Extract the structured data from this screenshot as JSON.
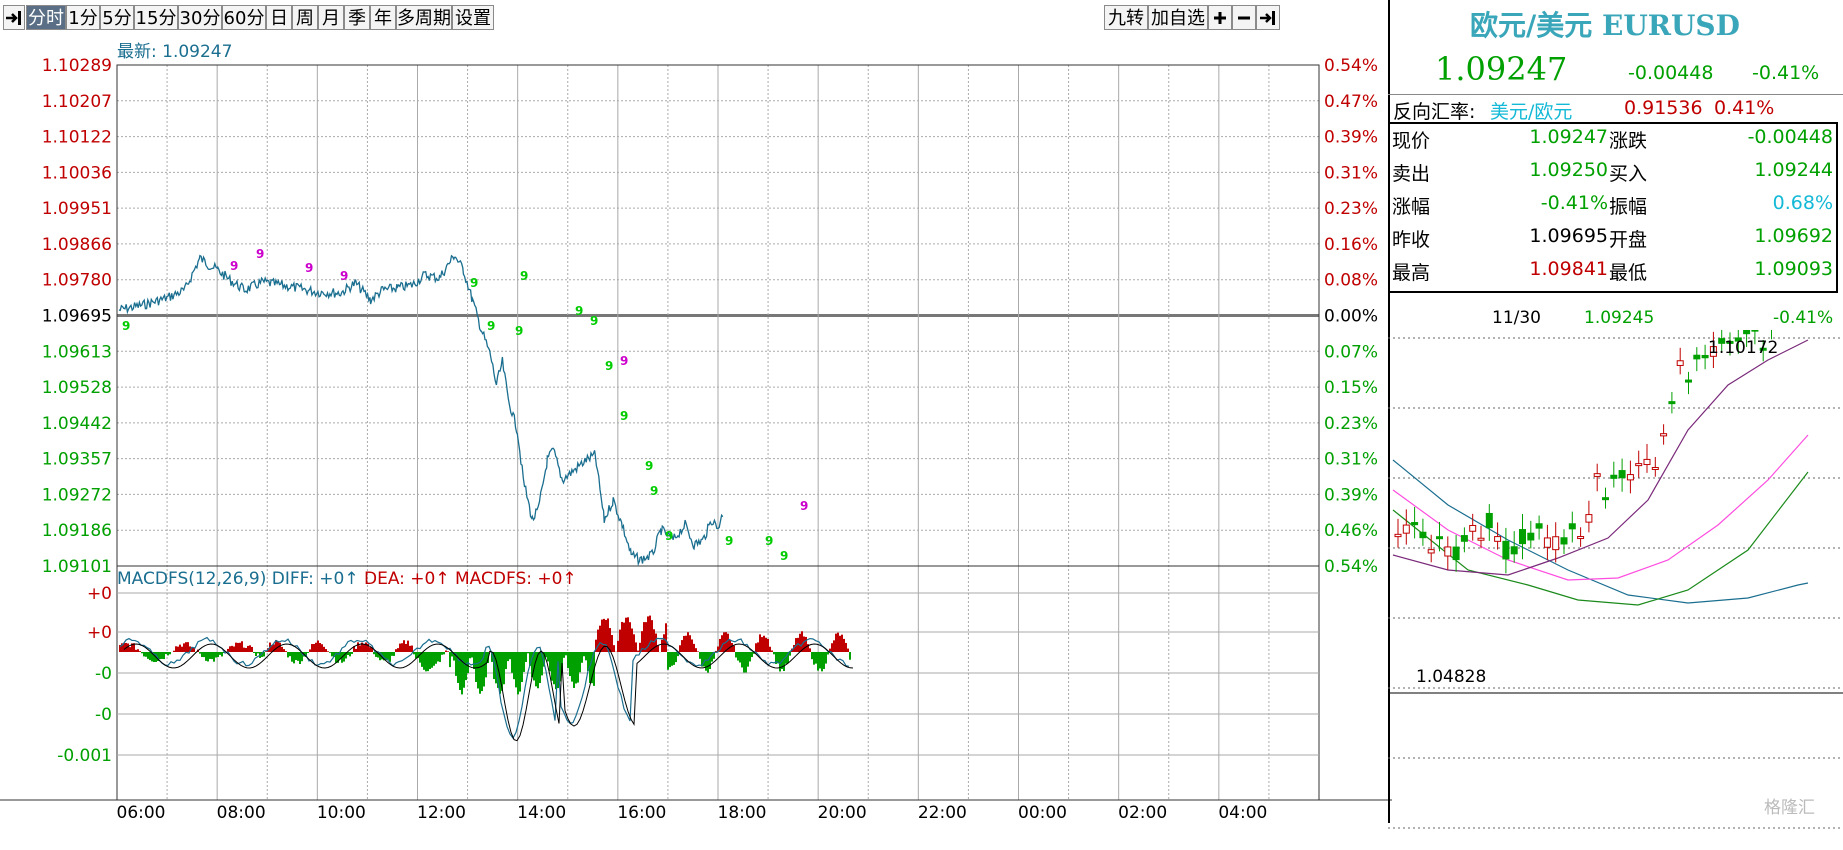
{
  "toolbar": {
    "left_items": [
      "分时",
      "1分",
      "5分",
      "15分",
      "30分",
      "60分",
      "日",
      "周",
      "月",
      "季",
      "年",
      "多周期",
      "设置"
    ],
    "active": "分时",
    "right_items": [
      "九转",
      "加自选"
    ],
    "zoom_in_icon": "plus-icon",
    "zoom_out_icon": "minus-icon",
    "nav_icon": "step-right-icon"
  },
  "main_chart": {
    "latest_label": "最新: 1.09247",
    "price_labels": [
      "1.10289",
      "1.10207",
      "1.10122",
      "1.10036",
      "1.09951",
      "1.09866",
      "1.09780",
      "1.09695",
      "1.09613",
      "1.09528",
      "1.09442",
      "1.09357",
      "1.09272",
      "1.09186",
      "1.09101"
    ],
    "pct_labels": [
      "0.54%",
      "0.47%",
      "0.39%",
      "0.31%",
      "0.23%",
      "0.16%",
      "0.08%",
      "0.00%",
      "0.07%",
      "0.15%",
      "0.23%",
      "0.31%",
      "0.39%",
      "0.46%",
      "0.54%"
    ],
    "time_labels": [
      "06:00",
      "08:00",
      "10:00",
      "12:00",
      "14:00",
      "16:00",
      "18:00",
      "20:00",
      "22:00",
      "00:00",
      "02:00",
      "04:00"
    ],
    "colors": {
      "up": "#c00000",
      "down": "#00a000",
      "line": "#1a6e8f",
      "baseline": "#777777",
      "macd_diff": "#1a6e8f",
      "macd_dea": "#000000"
    }
  },
  "macd": {
    "title": "MACDFS(12,26,9)",
    "diff_text": "DIFF: +0↑",
    "dea_text": "DEA: +0↑",
    "macdfs_text": "MACDFS: +0↑",
    "axis_labels": [
      "+0",
      "+0",
      "-0",
      "-0",
      "-0.001"
    ]
  },
  "quote": {
    "title": "欧元/美元 EURUSD",
    "price": "1.09247",
    "change": "-0.00448",
    "change_pct": "-0.41%",
    "reverse_label": "反向汇率:",
    "reverse_pair": "美元/欧元",
    "reverse_price": "0.91536",
    "reverse_pct": "0.41%",
    "rows": [
      {
        "l1": "现价",
        "v1": "1.09247",
        "c1": "grn",
        "l2": "涨跌",
        "v2": "-0.00448",
        "c2": "grn"
      },
      {
        "l1": "卖出",
        "v1": "1.09250",
        "c1": "grn",
        "l2": "买入",
        "v2": "1.09244",
        "c2": "grn"
      },
      {
        "l1": "涨幅",
        "v1": "-0.41%",
        "c1": "grn",
        "l2": "振幅",
        "v2": "0.68%",
        "c2": "cyan"
      },
      {
        "l1": "昨收",
        "v1": "1.09695",
        "c1": "blk",
        "l2": "开盘",
        "v2": "1.09692",
        "c2": "grn"
      },
      {
        "l1": "最高",
        "v1": "1.09841",
        "c1": "red",
        "l2": "最低",
        "v2": "1.09093",
        "c2": "grn"
      }
    ]
  },
  "mini_chart": {
    "date": "11/30",
    "price": "1.09245",
    "pct": "-0.41%",
    "high_label": "1.10172",
    "low_label": "1.04828"
  },
  "watermark": "格隆汇"
}
